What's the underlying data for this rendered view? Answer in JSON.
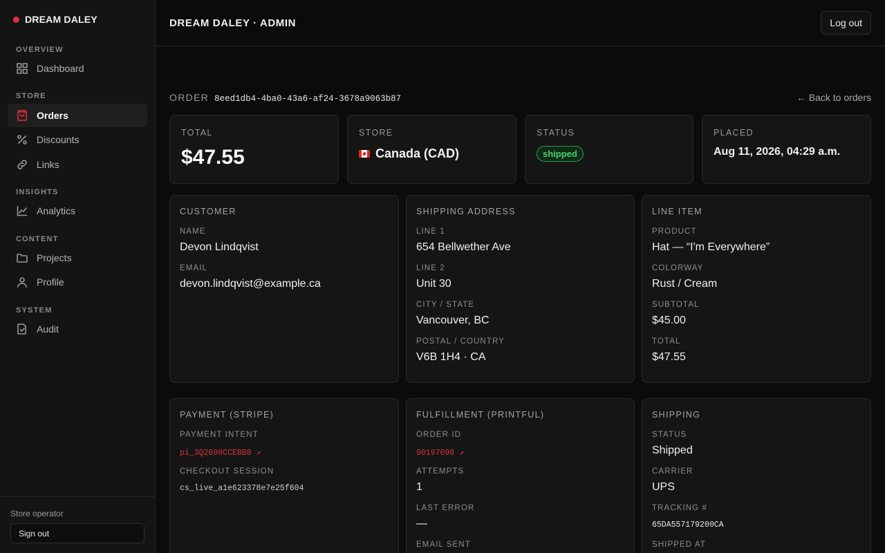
{
  "brand": {
    "name": "DREAM DALEY"
  },
  "sidebar": {
    "sections": {
      "overview": "OVERVIEW",
      "store": "STORE",
      "insights": "INSIGHTS",
      "content": "CONTENT",
      "system": "SYSTEM"
    },
    "items": {
      "dashboard": {
        "label": "Dashboard",
        "icon": "grid-icon"
      },
      "orders": {
        "label": "Orders",
        "icon": "bag-icon",
        "active": true
      },
      "discounts": {
        "label": "Discounts",
        "icon": "percent-icon"
      },
      "links": {
        "label": "Links",
        "icon": "link-icon"
      },
      "analytics": {
        "label": "Analytics",
        "icon": "chart-line-icon"
      },
      "projects": {
        "label": "Projects",
        "icon": "folder-icon"
      },
      "profile": {
        "label": "Profile",
        "icon": "user-icon"
      },
      "audit": {
        "label": "Audit",
        "icon": "file-check-icon"
      }
    },
    "footer": {
      "operator": "Store operator",
      "signout": "Sign out"
    }
  },
  "header": {
    "title": "DREAM DALEY · ADMIN",
    "logout": "Log out"
  },
  "order": {
    "label": "ORDER",
    "id": "8eed1db4-4ba0-43a6-af24-3678a9063b87",
    "back": "← Back to orders"
  },
  "summary": {
    "total": {
      "label": "TOTAL",
      "value": "$47.55"
    },
    "store": {
      "label": "STORE",
      "value": "Canada (CAD)",
      "flag": "canada-flag-icon"
    },
    "status": {
      "label": "STATUS",
      "value": "shipped",
      "color": "#4cd06f"
    },
    "placed": {
      "label": "PLACED",
      "value": "Aug 11, 2026, 04:29 a.m."
    }
  },
  "customer": {
    "title": "CUSTOMER",
    "name_label": "NAME",
    "name": "Devon Lindqvist",
    "email_label": "EMAIL",
    "email": "devon.lindqvist@example.ca"
  },
  "shipping_address": {
    "title": "SHIPPING ADDRESS",
    "line1_label": "LINE 1",
    "line1": "654 Bellwether Ave",
    "line2_label": "LINE 2",
    "line2": "Unit 30",
    "city_label": "CITY / STATE",
    "city": "Vancouver, BC",
    "postal_label": "POSTAL / COUNTRY",
    "postal": "V6B 1H4 · CA"
  },
  "line_item": {
    "title": "LINE ITEM",
    "product_label": "PRODUCT",
    "product": "Hat — “I'm Everywhere”",
    "colorway_label": "COLORWAY",
    "colorway": "Rust / Cream",
    "subtotal_label": "SUBTOTAL",
    "subtotal": "$45.00",
    "total_label": "TOTAL",
    "total": "$47.55"
  },
  "payment": {
    "title": "PAYMENT (STRIPE)",
    "intent_label": "PAYMENT INTENT",
    "intent": "pi_3Q2698CCEBB8 ↗",
    "session_label": "CHECKOUT SESSION",
    "session": "cs_live_a1e623378e7e25f604"
  },
  "fulfillment": {
    "title": "FULFILLMENT (PRINTFUL)",
    "order_id_label": "ORDER ID",
    "order_id": "90197096 ↗",
    "attempts_label": "ATTEMPTS",
    "attempts": "1",
    "last_error_label": "LAST ERROR",
    "last_error": "—",
    "email_sent_label": "EMAIL SENT"
  },
  "shipping": {
    "title": "SHIPPING",
    "status_label": "STATUS",
    "status": "Shipped",
    "carrier_label": "CARRIER",
    "carrier": "UPS",
    "tracking_label": "TRACKING #",
    "tracking": "65DA557179200CA",
    "shipped_at_label": "SHIPPED AT"
  },
  "colors": {
    "accent": "#e1303c",
    "background": "#0b0b0b",
    "panel": "#151515",
    "success": "#4cd06f"
  }
}
